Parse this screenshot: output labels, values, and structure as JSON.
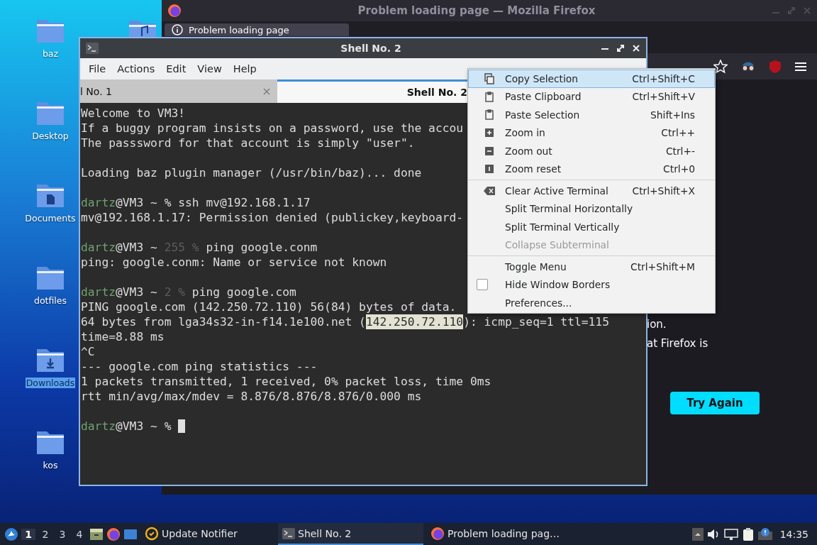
{
  "desktop": {
    "icons": [
      {
        "label": "baz",
        "selected": false
      },
      {
        "label": "Desktop",
        "selected": false
      },
      {
        "label": "Documents",
        "selected": false
      },
      {
        "label": "dotfiles",
        "selected": false
      },
      {
        "label": "Downloads",
        "selected": true
      },
      {
        "label": "kos",
        "selected": false
      }
    ]
  },
  "firefox": {
    "title": "Problem loading page — Mozilla Firefox",
    "tab": "Problem loading page",
    "page_lines": [
      "ion.",
      "at Firefox is"
    ],
    "button": "Try Again"
  },
  "terminal": {
    "title": "Shell No. 2",
    "menu": [
      "File",
      "Actions",
      "Edit",
      "View",
      "Help"
    ],
    "tabs": [
      {
        "label": "l No. 1",
        "selected": false
      },
      {
        "label": "Shell No. 2",
        "selected": true
      }
    ],
    "lines": [
      {
        "kind": "text",
        "text": "Welcome to VM3!"
      },
      {
        "kind": "text",
        "text": "If a buggy program insists on a password, use the accou"
      },
      {
        "kind": "text",
        "text": "The passsword for that account is simply \"user\"."
      },
      {
        "kind": "blank"
      },
      {
        "kind": "text",
        "text": "Loading baz plugin manager (/usr/bin/baz)... done"
      },
      {
        "kind": "blank"
      },
      {
        "kind": "prompt",
        "user": "dartz",
        "host": "@VM3 ~",
        "sign": "%",
        "command": "ssh mv@192.168.1.17",
        "cursor": false
      },
      {
        "kind": "text",
        "text": "mv@192.168.1.17: Permission denied (publickey,keyboard-"
      },
      {
        "kind": "blank"
      },
      {
        "kind": "prompt",
        "user": "dartz",
        "host": "@VM3 ~",
        "status": "255",
        "sign": "%",
        "command": "ping google.conm",
        "cursor": false
      },
      {
        "kind": "text",
        "text": "ping: google.conm: Name or service not known"
      },
      {
        "kind": "blank"
      },
      {
        "kind": "prompt",
        "user": "dartz",
        "host": "@VM3 ~",
        "status": "2",
        "sign": "%",
        "command": "ping google.com",
        "cursor": false
      },
      {
        "kind": "text",
        "text": "PING google.com (142.250.72.110) 56(84) bytes of data."
      },
      {
        "kind": "selection",
        "before": "64 bytes from lga34s32-in-f14.1e100.net (",
        "selected": "142.250.72.110",
        "after": "): icmp_seq=1 ttl=115"
      },
      {
        "kind": "text",
        "text": "time=8.88 ms"
      },
      {
        "kind": "text",
        "text": "^C"
      },
      {
        "kind": "text",
        "text": "--- google.com ping statistics ---"
      },
      {
        "kind": "text",
        "text": "1 packets transmitted, 1 received, 0% packet loss, time 0ms"
      },
      {
        "kind": "text",
        "text": "rtt min/avg/max/mdev = 8.876/8.876/8.876/0.000 ms"
      },
      {
        "kind": "blank"
      },
      {
        "kind": "prompt",
        "user": "dartz",
        "host": "@VM3 ~",
        "sign": "%",
        "cursor": true
      }
    ]
  },
  "context_menu": {
    "items": [
      {
        "kind": "action",
        "label": "Copy Selection",
        "shortcut": "Ctrl+Shift+C",
        "selected": true,
        "disabled": false
      },
      {
        "kind": "action",
        "label": "Paste Clipboard",
        "shortcut": "Ctrl+Shift+V",
        "selected": false,
        "disabled": false
      },
      {
        "kind": "action",
        "label": "Paste Selection",
        "shortcut": "Shift+Ins",
        "selected": false,
        "disabled": false
      },
      {
        "kind": "action",
        "label": "Zoom in",
        "shortcut": "Ctrl++",
        "selected": false,
        "disabled": false
      },
      {
        "kind": "action",
        "label": "Zoom out",
        "shortcut": "Ctrl+-",
        "selected": false,
        "disabled": false
      },
      {
        "kind": "action",
        "label": "Zoom reset",
        "shortcut": "Ctrl+0",
        "selected": false,
        "disabled": false
      },
      {
        "kind": "separator"
      },
      {
        "kind": "action",
        "label": "Clear Active Terminal",
        "shortcut": "Ctrl+Shift+X",
        "selected": false,
        "disabled": false
      },
      {
        "kind": "action",
        "label": "Split Terminal Horizontally",
        "selected": false,
        "disabled": false
      },
      {
        "kind": "action",
        "label": "Split Terminal Vertically",
        "selected": false,
        "disabled": false
      },
      {
        "kind": "action",
        "label": "Collapse Subterminal",
        "selected": false,
        "disabled": true
      },
      {
        "kind": "separator"
      },
      {
        "kind": "action",
        "label": "Toggle Menu",
        "shortcut": "Ctrl+Shift+M",
        "selected": false,
        "disabled": false
      },
      {
        "kind": "checkbox",
        "label": "Hide Window Borders",
        "checked": false,
        "selected": false,
        "disabled": false
      },
      {
        "kind": "action",
        "label": "Preferences...",
        "selected": false,
        "disabled": false
      }
    ]
  },
  "taskbar": {
    "workspaces": [
      {
        "label": "1",
        "selected": true
      },
      {
        "label": "2",
        "selected": false
      },
      {
        "label": "3",
        "selected": false
      },
      {
        "label": "4",
        "selected": false
      }
    ],
    "tasks": [
      {
        "label": "Update Notifier",
        "selected": false
      },
      {
        "label": "Shell No. 2",
        "selected": true
      },
      {
        "label": "Problem loading pag…",
        "selected": false
      }
    ],
    "clock": "14:35"
  }
}
